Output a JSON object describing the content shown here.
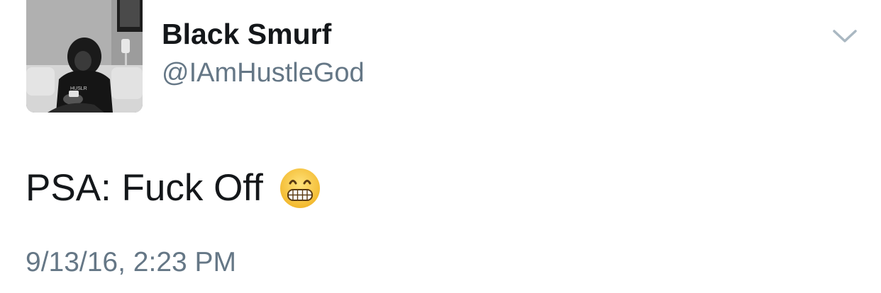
{
  "tweet": {
    "display_name": "Black Smurf",
    "handle": "@IAmHustleGod",
    "text": "PSA: Fuck Off",
    "emoji": "grimacing-face-emoji",
    "timestamp": "9/13/16, 2:23 PM",
    "avatar_shirt_text": "HUSLR"
  },
  "icons": {
    "menu": "chevron-down-icon"
  },
  "colors": {
    "name": "#14171a",
    "secondary": "#657786",
    "chevron": "#aab8c2",
    "emoji_face": "#f7c948"
  }
}
